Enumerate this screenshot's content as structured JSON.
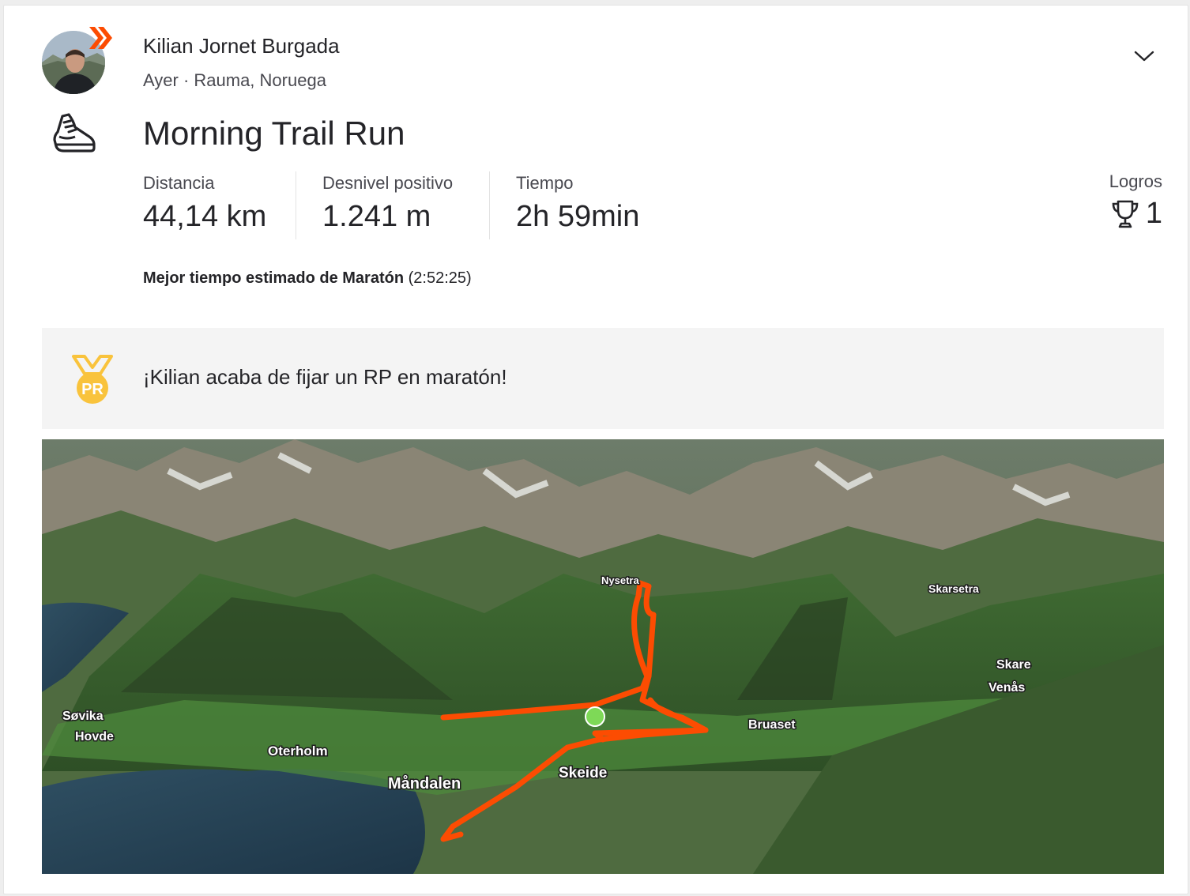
{
  "athlete": {
    "name": "Kilian Jornet Burgada",
    "meta": "Ayer · Rauma, Noruega",
    "badge_icon": "subscriber-chevrons-icon"
  },
  "activity": {
    "sport_icon": "running-shoe-icon",
    "title": "Morning Trail Run",
    "stats": [
      {
        "label": "Distancia",
        "value": "44,14 km"
      },
      {
        "label": "Desnivel positivo",
        "value": "1.241 m"
      },
      {
        "label": "Tiempo",
        "value": "2h 59min"
      }
    ],
    "achievements": {
      "label": "Logros",
      "count": "1",
      "icon": "trophy-icon"
    },
    "best_estimate": {
      "label": "Mejor tiempo estimado de Maratón",
      "value": "(2:52:25)"
    }
  },
  "pr_banner": {
    "icon": "pr-medal-icon",
    "medal_text": "PR",
    "text": "¡Kilian acaba de fijar un RP en maratón!"
  },
  "map": {
    "labels": [
      "Nysetra",
      "Skarsetra",
      "Skare",
      "Venås",
      "Søvika",
      "Hovde",
      "Oterholm",
      "Bruaset",
      "Skeide",
      "Måndalen"
    ],
    "route_color": "#fc4c02",
    "start_marker_color": "#7ed957"
  },
  "colors": {
    "brand_orange": "#fc4c02",
    "medal_gold": "#f9c33c",
    "text_primary": "#242428",
    "text_secondary": "#494950"
  }
}
